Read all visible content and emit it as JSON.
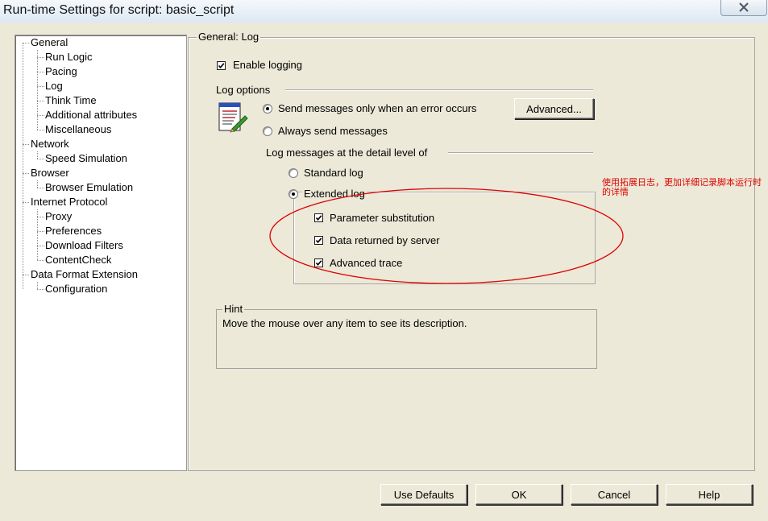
{
  "window": {
    "title": "Run-time Settings for script: basic_script",
    "close_icon": "close-icon"
  },
  "tree": {
    "items": [
      {
        "label": "General",
        "level": 0
      },
      {
        "label": "Run Logic",
        "level": 1
      },
      {
        "label": "Pacing",
        "level": 1
      },
      {
        "label": "Log",
        "level": 1
      },
      {
        "label": "Think Time",
        "level": 1
      },
      {
        "label": "Additional attributes",
        "level": 1
      },
      {
        "label": "Miscellaneous",
        "level": 1
      },
      {
        "label": "Network",
        "level": 0
      },
      {
        "label": "Speed Simulation",
        "level": 1
      },
      {
        "label": "Browser",
        "level": 0
      },
      {
        "label": "Browser Emulation",
        "level": 1
      },
      {
        "label": "Internet Protocol",
        "level": 0
      },
      {
        "label": "Proxy",
        "level": 1
      },
      {
        "label": "Preferences",
        "level": 1
      },
      {
        "label": "Download Filters",
        "level": 1
      },
      {
        "label": "ContentCheck",
        "level": 1
      },
      {
        "label": "Data Format Extension",
        "level": 0
      },
      {
        "label": "Configuration",
        "level": 1
      }
    ]
  },
  "panel": {
    "title": "General: Log",
    "enable_logging": {
      "label": "Enable logging",
      "checked": true
    },
    "log_options": {
      "heading": "Log options",
      "icon": "log-document-icon",
      "send_on_error": {
        "label": "Send messages only when an error occurs",
        "selected": true
      },
      "always_send": {
        "label": "Always send messages",
        "selected": false
      },
      "advanced_button": "Advanced..."
    },
    "detail_level": {
      "heading": "Log messages at the detail level of",
      "standard": {
        "label": "Standard log",
        "selected": false
      },
      "extended": {
        "label": "Extended log",
        "selected": true
      },
      "options": [
        {
          "label": "Parameter substitution",
          "checked": true
        },
        {
          "label": "Data returned by server",
          "checked": true
        },
        {
          "label": "Advanced trace",
          "checked": true
        }
      ]
    },
    "hint": {
      "title": "Hint",
      "text": "Move the mouse over any item to see its description."
    }
  },
  "annotation": {
    "text": "使用拓展日志，更加详细记录脚本运行时的详情",
    "color": "#e00000"
  },
  "buttons": {
    "use_defaults": "Use Defaults",
    "ok": "OK",
    "cancel": "Cancel",
    "help": "Help"
  }
}
